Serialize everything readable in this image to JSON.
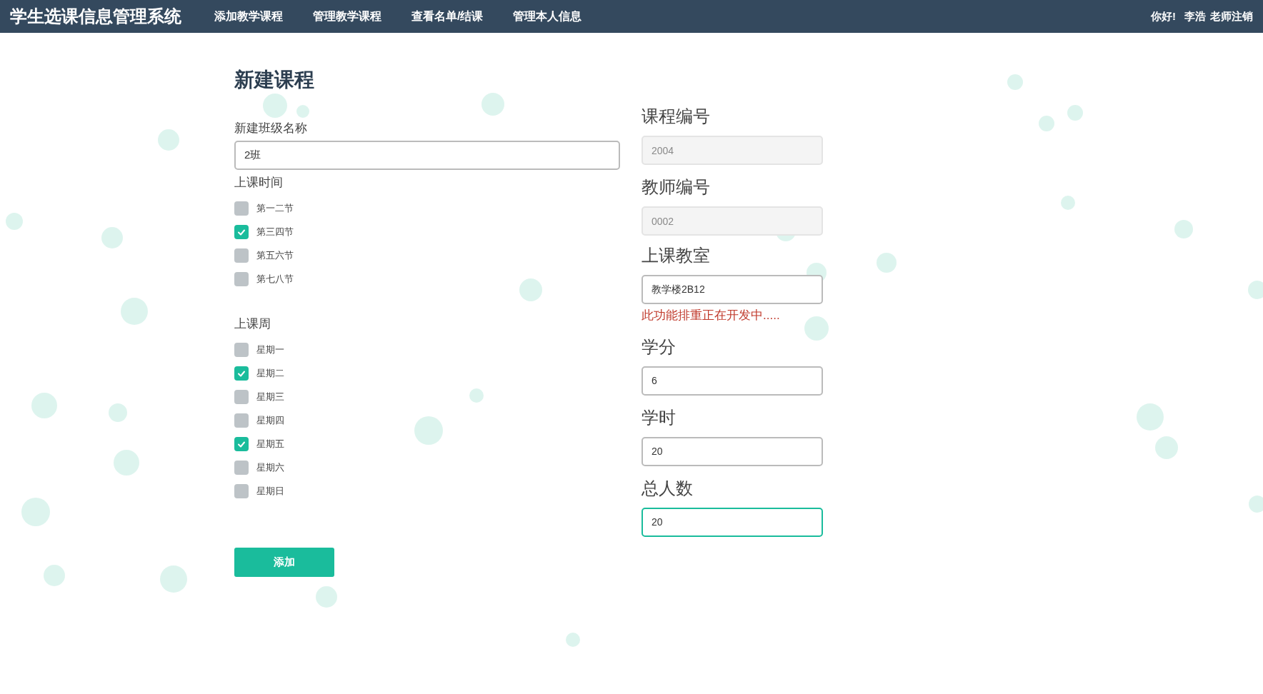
{
  "navbar": {
    "brand": "学生选课信息管理系统",
    "links": [
      {
        "label": "添加教学课程"
      },
      {
        "label": "管理教学课程"
      },
      {
        "label": "查看名单/结课"
      },
      {
        "label": "管理本人信息"
      }
    ],
    "greeting": "你好!",
    "user": "李浩",
    "logout": "老师注销"
  },
  "form": {
    "title": "新建课程",
    "class_name": {
      "label": "新建班级名称",
      "value": "2班"
    },
    "periods": {
      "label": "上课时间",
      "options": [
        {
          "label": "第一二节",
          "checked": false
        },
        {
          "label": "第三四节",
          "checked": true
        },
        {
          "label": "第五六节",
          "checked": false
        },
        {
          "label": "第七八节",
          "checked": false
        }
      ]
    },
    "weekdays": {
      "label": "上课周",
      "options": [
        {
          "label": "星期一",
          "checked": false
        },
        {
          "label": "星期二",
          "checked": true
        },
        {
          "label": "星期三",
          "checked": false
        },
        {
          "label": "星期四",
          "checked": false
        },
        {
          "label": "星期五",
          "checked": true
        },
        {
          "label": "星期六",
          "checked": false
        },
        {
          "label": "星期日",
          "checked": false
        }
      ]
    },
    "submit": "添加",
    "fields": [
      {
        "label": "课程编号",
        "value": "2004",
        "disabled": true,
        "focused": false
      },
      {
        "label": "教师编号",
        "value": "0002",
        "disabled": true,
        "focused": false
      },
      {
        "label": "上课教室",
        "value": "教学楼2B12",
        "disabled": false,
        "focused": false,
        "note": "此功能排重正在开发中....."
      },
      {
        "label": "学分",
        "value": "6",
        "disabled": false,
        "focused": false
      },
      {
        "label": "学时",
        "value": "20",
        "disabled": false,
        "focused": false
      },
      {
        "label": "总人数",
        "value": "20",
        "disabled": false,
        "focused": true
      }
    ]
  }
}
